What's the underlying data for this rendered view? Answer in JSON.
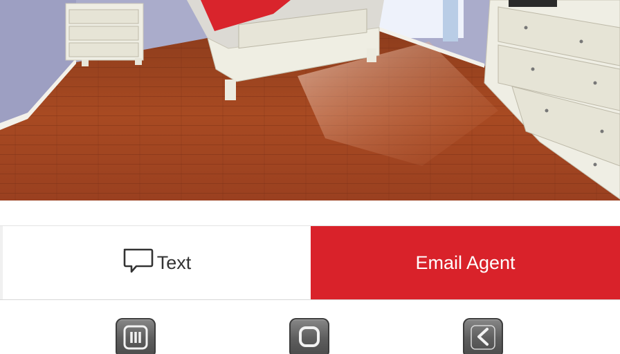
{
  "photo": {
    "subject": "bedroom-hardwood-floor-image"
  },
  "actions": {
    "text_label": "Text",
    "text_icon": "chat-bubble-icon",
    "email_label": "Email Agent",
    "email_color": "#d9222a"
  },
  "nav": {
    "recents_icon": "recents-icon",
    "home_icon": "home-icon",
    "back_icon": "back-icon"
  },
  "colors": {
    "accent": "#d9222a",
    "floor": "#a34a22",
    "wall": "#a9aac8",
    "furniture": "#ecebe0"
  }
}
